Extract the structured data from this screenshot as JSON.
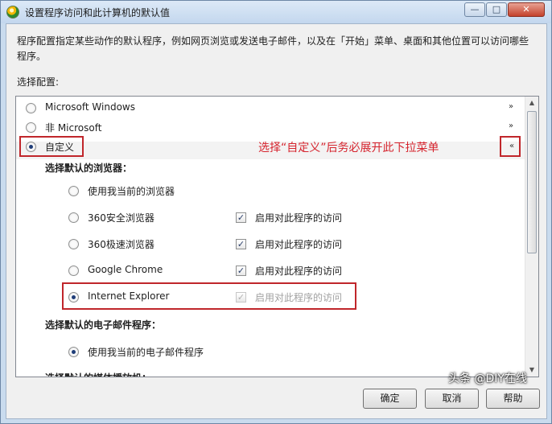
{
  "window": {
    "title": "设置程序访问和此计算机的默认值",
    "controls": {
      "minimize": "—",
      "maximize": "□",
      "close": "✕"
    }
  },
  "description": "程序配置指定某些动作的默认程序，例如网页浏览或发送电子邮件，以及在「开始」菜单、桌面和其他位置可以访问哪些程序。",
  "select_config_label": "选择配置:",
  "configs": [
    {
      "label": "Microsoft Windows",
      "selected": false,
      "expander": "chevron-double-down"
    },
    {
      "label": "非 Microsoft",
      "selected": false,
      "expander": "chevron-double-down"
    },
    {
      "label": "自定义",
      "selected": true,
      "expander": "chevron-double-up"
    }
  ],
  "custom": {
    "browser_heading": "选择默认的浏览器：",
    "browsers": [
      {
        "label": "使用我当前的浏览器",
        "selected": false
      },
      {
        "label": "360安全浏览器",
        "selected": false,
        "access_label": "启用对此程序的访问",
        "access_checked": true,
        "access_disabled": false
      },
      {
        "label": "360极速浏览器",
        "selected": false,
        "access_label": "启用对此程序的访问",
        "access_checked": true,
        "access_disabled": false
      },
      {
        "label": "Google Chrome",
        "selected": false,
        "access_label": "启用对此程序的访问",
        "access_checked": true,
        "access_disabled": false
      },
      {
        "label": "Internet Explorer",
        "selected": true,
        "access_label": "启用对此程序的访问",
        "access_checked": true,
        "access_disabled": true
      }
    ],
    "email_heading": "选择默认的电子邮件程序：",
    "email_options": [
      {
        "label": "使用我当前的电子邮件程序",
        "selected": true
      }
    ],
    "media_heading": "选择默认的媒体播放机："
  },
  "annotation": {
    "text": "选择“自定义”后务必展开此下拉菜单",
    "color": "#d6242e"
  },
  "buttons": {
    "ok": "确定",
    "cancel": "取消",
    "help": "帮助"
  },
  "watermark": "头条 @DIY在线",
  "icons": {
    "title": "program-access-icon",
    "check_mark": "✓",
    "chevron_down": "»",
    "chevron_up": "«",
    "scroll_up": "▲",
    "scroll_down": "▼"
  }
}
